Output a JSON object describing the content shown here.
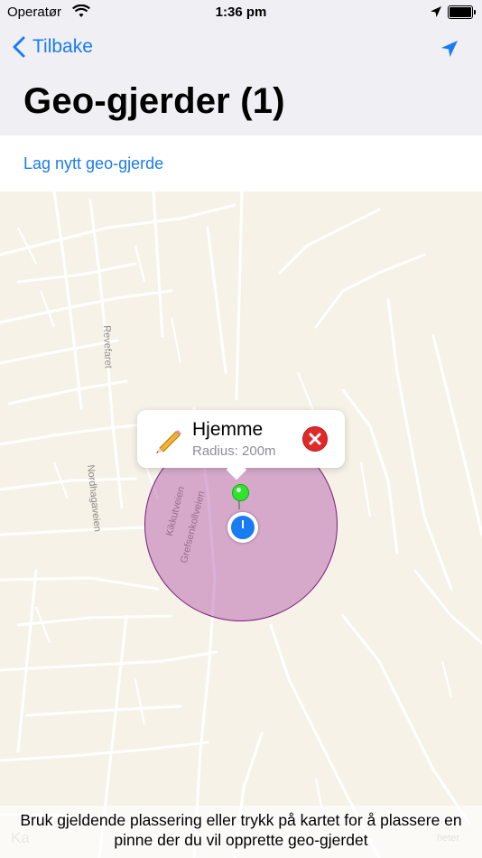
{
  "status_bar": {
    "carrier": "Operatør",
    "time": "1:36 pm"
  },
  "nav": {
    "back_label": "Tilbake",
    "title": "Geo-gjerder (1)"
  },
  "actions": {
    "new_geofence_label": "Lag nytt geo-gjerde"
  },
  "map": {
    "street_labels": [
      "Revefaret",
      "Nordhagaveien",
      "Kikkutveien",
      "Grefsenkollveien"
    ],
    "callout": {
      "name": "Hjemme",
      "radius_text": "Radius: 200m"
    },
    "instruction": "Bruk gjeldende plassering eller trykk på kartet for å plassere en pinne der du vil opprette geo-gjerdet",
    "legal_text": "heter",
    "logo_text": "Ka"
  },
  "colors": {
    "accent": "#1a7cf3",
    "geofence_fill": "#aa46a0",
    "geofence_stroke": "#7a1c78",
    "pin": "#2fe32f",
    "delete": "#e02a2a"
  },
  "icons": [
    "wifi-icon",
    "location-arrow-icon",
    "battery-icon",
    "chevron-left-icon",
    "pencil-icon",
    "close-icon"
  ]
}
